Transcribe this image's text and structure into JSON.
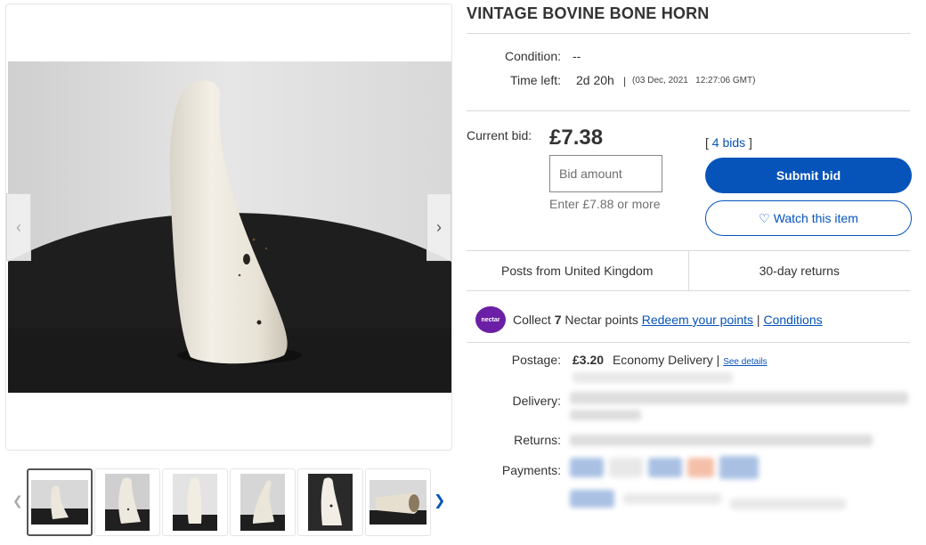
{
  "listing": {
    "title": "VINTAGE BOVINE BONE HORN"
  },
  "details": {
    "condition_label": "Condition:",
    "condition_value": "--",
    "time_left_label": "Time left:",
    "time_left_value": "2d 20h",
    "end_separator": "|",
    "end_time": "(03 Dec, 2021   12:27:06 GMT)"
  },
  "bid": {
    "current_label": "Current bid:",
    "current_value": "£7.38",
    "input_placeholder": "Bid amount",
    "hint": "Enter £7.88 or more",
    "bids_open": "[",
    "bids_link": "4 bids",
    "bids_close": "]",
    "submit_label": "Submit bid",
    "watch_label": "Watch this item"
  },
  "shipping_summary": {
    "origin": "Posts from United Kingdom",
    "returns": "30-day returns"
  },
  "nectar": {
    "logo_text": "nectar",
    "collect_prefix": "Collect ",
    "points": "7",
    "collect_suffix": " Nectar points ",
    "redeem_link": "Redeem your points",
    "separator": " | ",
    "conditions_link": "Conditions"
  },
  "postage": {
    "postage_label": "Postage:",
    "postage_price": "£3.20",
    "postage_method": "Economy Delivery",
    "separator": " | ",
    "see_details": "See details",
    "delivery_label": "Delivery:",
    "returns_label": "Returns:",
    "payments_label": "Payments:"
  },
  "gallery": {
    "prev_icon": "chevron-left-icon",
    "next_icon": "chevron-right-icon",
    "thumbnail_count": 6
  },
  "colors": {
    "primary_blue": "#0654ba",
    "nectar_purple": "#6b1fa6",
    "divider": "#d9d9d9"
  }
}
